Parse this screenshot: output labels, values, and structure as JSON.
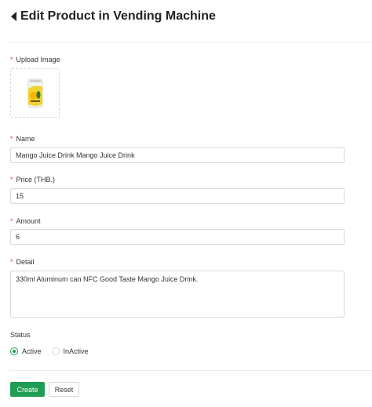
{
  "header": {
    "title": "Edit Product in Vending Machine",
    "back_icon": "caret-left-icon"
  },
  "form": {
    "required_mark": "*",
    "upload": {
      "label": "Upload Image",
      "image_alt": "Mango juice can"
    },
    "name": {
      "label": "Name",
      "value": "Mango Juice Drink Mango Juice Drink"
    },
    "price": {
      "label": "Price (THB.)",
      "value": "15"
    },
    "amount": {
      "label": "Amount",
      "value": "6"
    },
    "detail": {
      "label": "Detail",
      "value": "330ml Aluminum can NFC Good Taste Mango Juice Drink."
    },
    "status": {
      "label": "Status",
      "options": [
        {
          "label": "Active",
          "checked": true
        },
        {
          "label": "InActive",
          "checked": false
        }
      ]
    }
  },
  "actions": {
    "create_label": "Create",
    "reset_label": "Reset"
  },
  "colors": {
    "primary": "#1f9d55",
    "required": "#e74c3c",
    "border": "#d9d9d9"
  }
}
